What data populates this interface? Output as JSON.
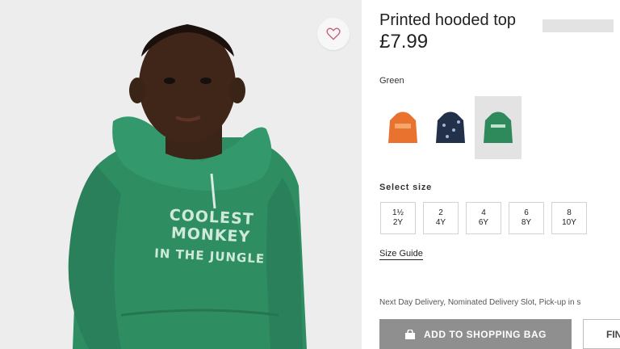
{
  "product": {
    "title": "Printed hooded top",
    "price": "£7.99",
    "image_print_line1": "COOLEST MONKEY",
    "image_print_line2": "IN THE JUNGLE"
  },
  "color": {
    "selected_label": "Green",
    "swatches": [
      {
        "name": "orange",
        "hex": "#e8722e"
      },
      {
        "name": "navy-print",
        "hex": "#23304a"
      },
      {
        "name": "green",
        "hex": "#2f8a5b"
      }
    ],
    "selected_index": 2
  },
  "size": {
    "label": "Select size",
    "options": [
      {
        "top": "1½",
        "bottom": "2Y"
      },
      {
        "top": "2",
        "bottom": "4Y"
      },
      {
        "top": "4",
        "bottom": "6Y"
      },
      {
        "top": "6",
        "bottom": "8Y"
      },
      {
        "top": "8",
        "bottom": "10Y"
      }
    ],
    "guide_label": "Size Guide"
  },
  "delivery_text": "Next Day Delivery, Nominated Delivery Slot, Pick-up in s",
  "actions": {
    "add_to_bag": "ADD TO SHOPPING BAG",
    "find_in_store": "FIN"
  },
  "colors": {
    "hoodie_green": "#2e8b63",
    "button_grey": "#8f8f8f"
  }
}
